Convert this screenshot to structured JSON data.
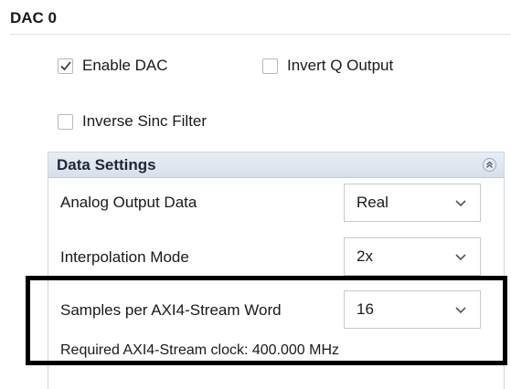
{
  "section": {
    "title": "DAC 0"
  },
  "options": {
    "enable_dac": {
      "label": "Enable DAC",
      "checked": true
    },
    "invert_q_output": {
      "label": "Invert Q Output",
      "checked": false
    },
    "inverse_sinc_filter": {
      "label": "Inverse Sinc Filter",
      "checked": false
    }
  },
  "data_settings": {
    "title": "Data Settings",
    "collapse_icon": "double-chevron-up-icon",
    "fields": [
      {
        "label": "Analog Output Data",
        "value": "Real"
      },
      {
        "label": "Interpolation Mode",
        "value": "2x"
      },
      {
        "label": "Samples per AXI4-Stream Word",
        "value": "16"
      }
    ],
    "clock_text": "Required AXI4-Stream clock: 400.000 MHz"
  },
  "colors": {
    "panel_header": "#dde5ee",
    "panel_border": "#cfd6de",
    "highlight": "#000000"
  }
}
